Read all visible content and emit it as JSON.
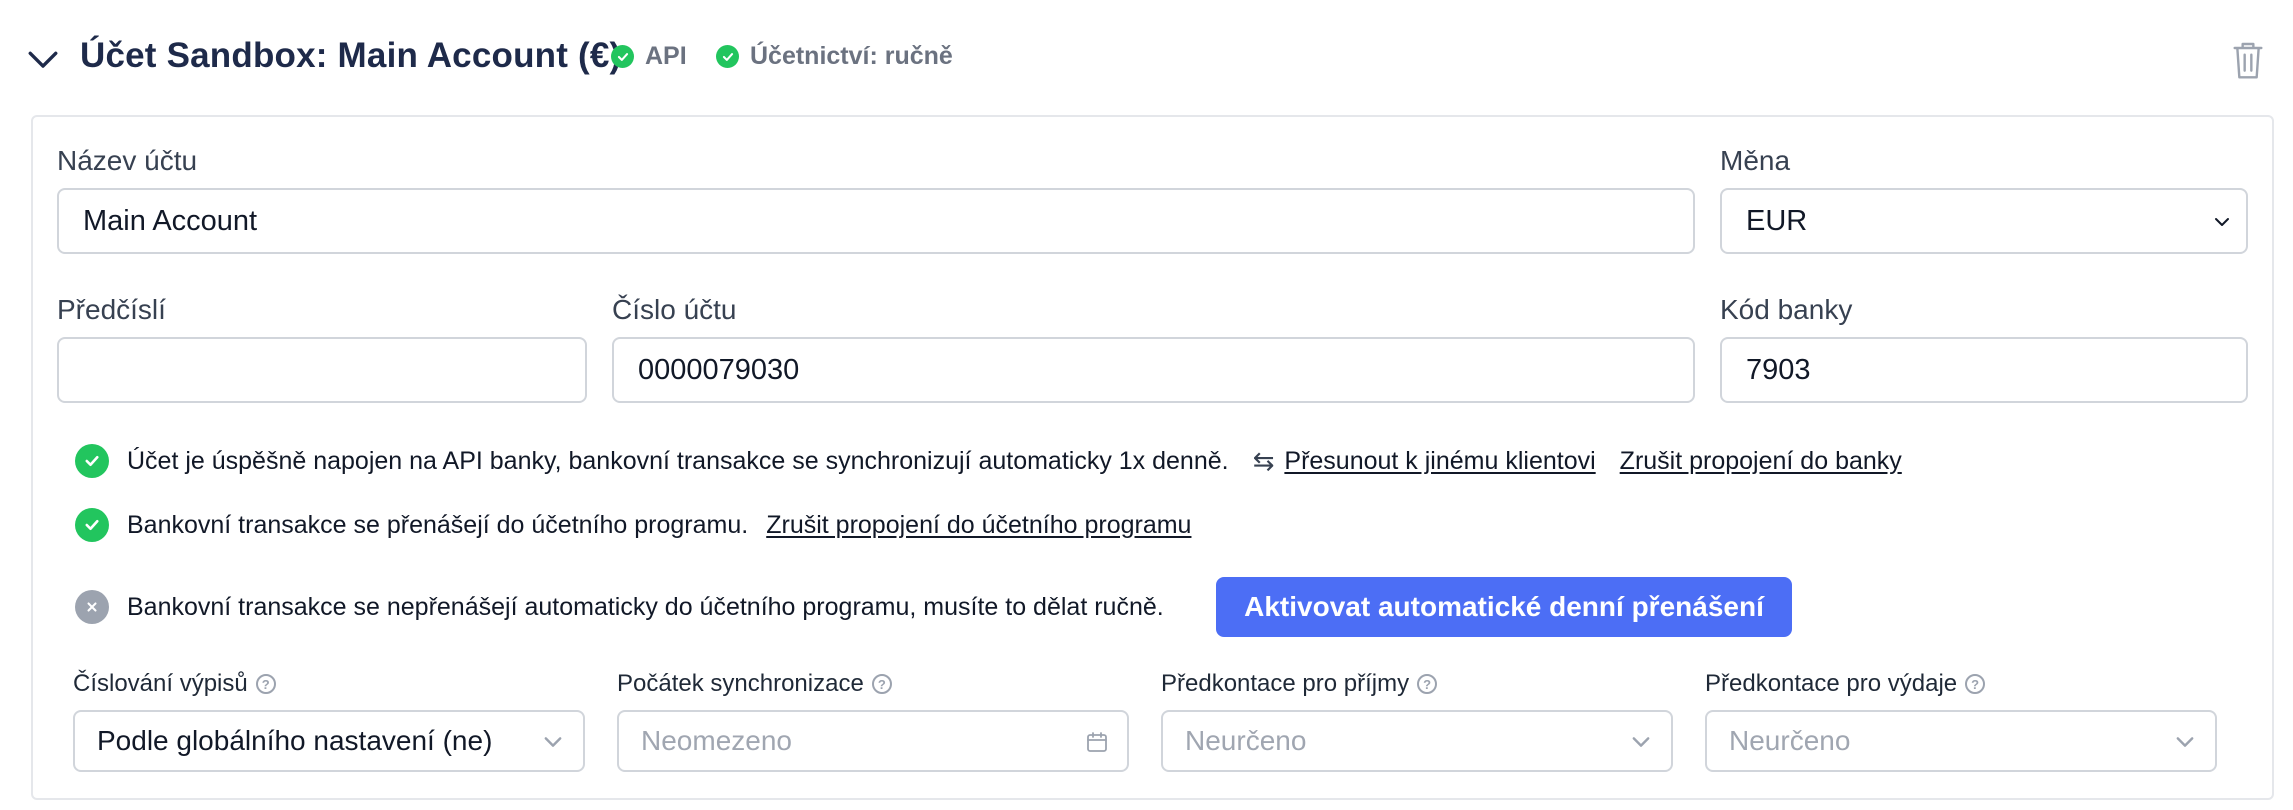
{
  "header": {
    "title": "Účet Sandbox: Main Account (€)",
    "badge_api": "API",
    "badge_accounting": "Účetnictví: ručně"
  },
  "form": {
    "account_name_label": "Název účtu",
    "account_name_value": "Main Account",
    "currency_label": "Měna",
    "currency_value": "EUR",
    "prefix_label": "Předčíslí",
    "prefix_value": "",
    "account_number_label": "Číslo účtu",
    "account_number_value": "0000079030",
    "bank_code_label": "Kód banky",
    "bank_code_value": "7903"
  },
  "status": {
    "api_connected": "Účet je úspěšně napojen na API banky, bankovní transakce se synchronizují automaticky 1x denně.",
    "move_client_link": "Přesunout k jinému klientovi",
    "cancel_bank_link": "Zrušit propojení do banky",
    "transfer_accounting": "Bankovní transakce se přenášejí do účetního programu.",
    "cancel_accounting_link": "Zrušit propojení do účetního programu",
    "no_auto_transfer": "Bankovní transakce se nepřenášejí automaticky do účetního programu, musíte to dělat ručně.",
    "activate_button": "Aktivovat automatické denní přenášení"
  },
  "settings": {
    "numbering_label": "Číslování výpisů",
    "numbering_value": "Podle globálního nastavení (ne)",
    "sync_start_label": "Počátek synchronizace",
    "sync_start_placeholder": "Neomezeno",
    "income_label": "Předkontace pro příjmy",
    "income_value": "Neurčeno",
    "expense_label": "Předkontace pro výdaje",
    "expense_value": "Neurčeno"
  },
  "colors": {
    "accent": "#4c6ef5",
    "success": "#22c55e",
    "muted": "#9ca3af",
    "title": "#1e2a4a"
  },
  "icons": [
    "chevron-down-icon",
    "check-circle-icon",
    "trash-icon",
    "x-circle-icon",
    "transfer-icon",
    "help-icon",
    "calendar-icon"
  ]
}
